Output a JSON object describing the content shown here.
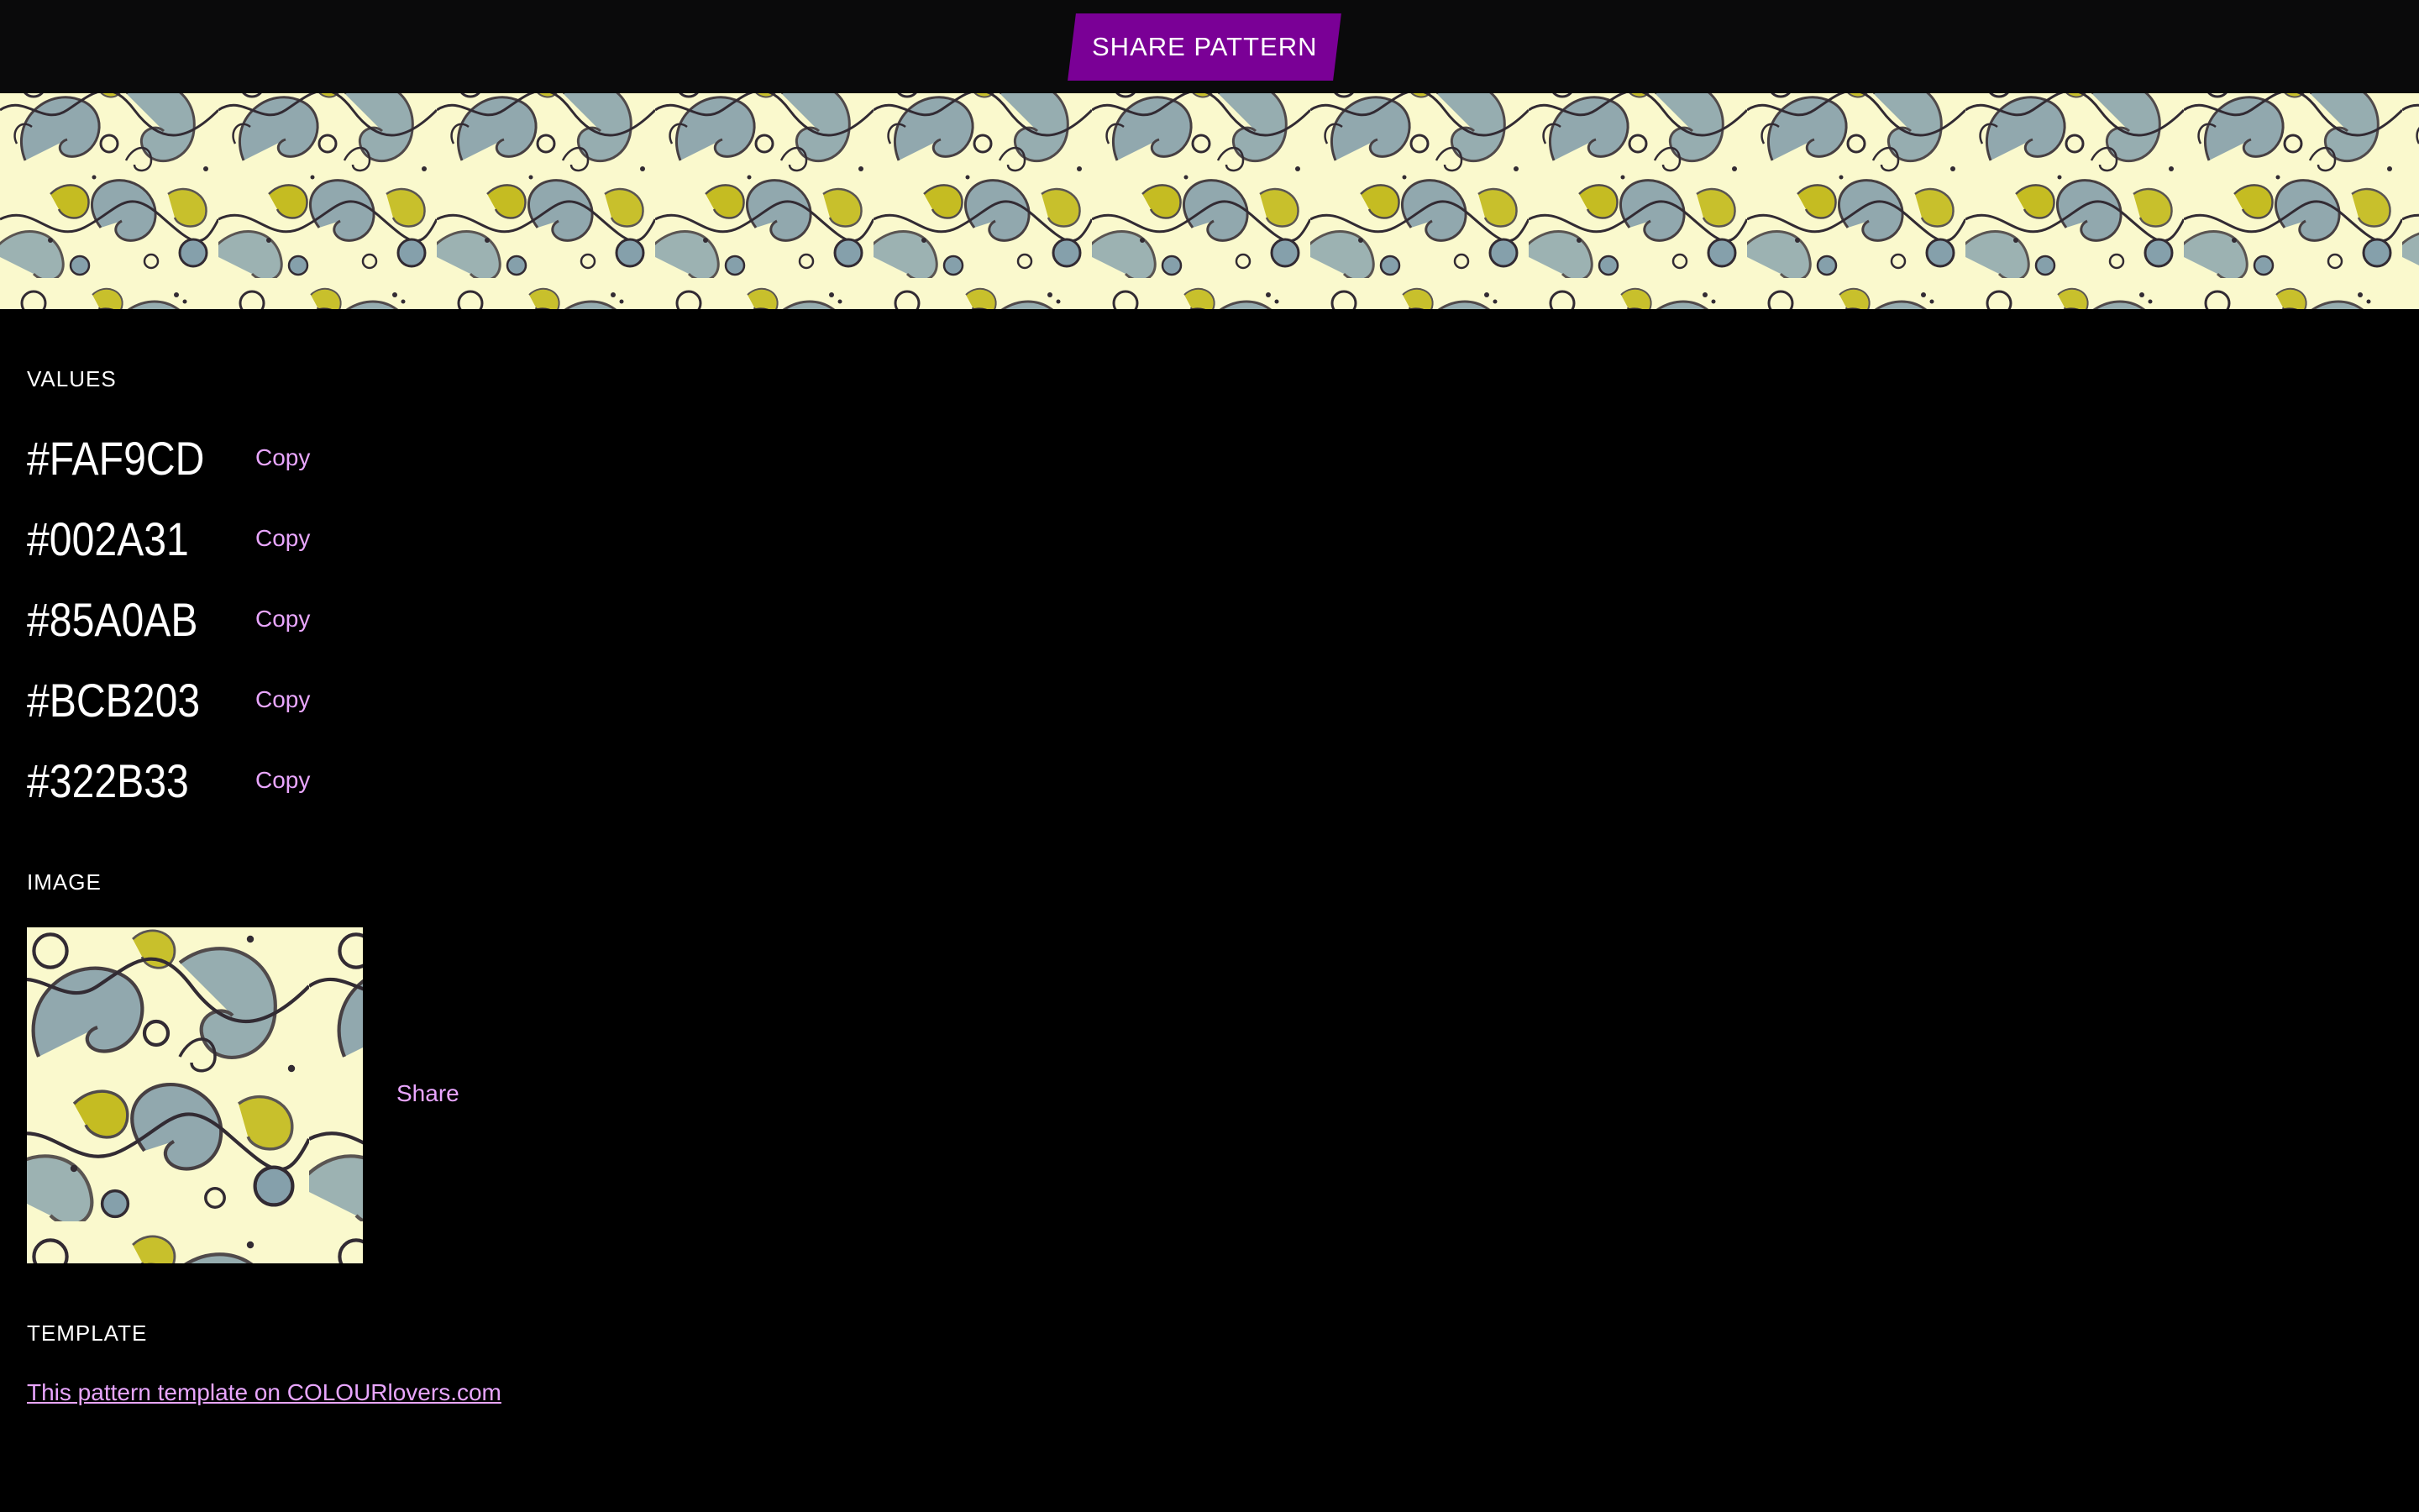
{
  "header": {
    "share_button_label": "SHARE PATTERN",
    "accent_color": "#7a0096"
  },
  "sections": {
    "values_title": "VALUES",
    "image_title": "IMAGE",
    "template_title": "TEMPLATE"
  },
  "values": [
    {
      "hex": "#FAF9CD",
      "copy_label": "Copy"
    },
    {
      "hex": "#002A31",
      "copy_label": "Copy"
    },
    {
      "hex": "#85A0AB",
      "copy_label": "Copy"
    },
    {
      "hex": "#BCB203",
      "copy_label": "Copy"
    },
    {
      "hex": "#322B33",
      "copy_label": "Copy"
    }
  ],
  "image": {
    "share_label": "Share"
  },
  "template": {
    "link_text": "This pattern template on COLOURlovers.com"
  },
  "link_color": "#e9a6ff"
}
